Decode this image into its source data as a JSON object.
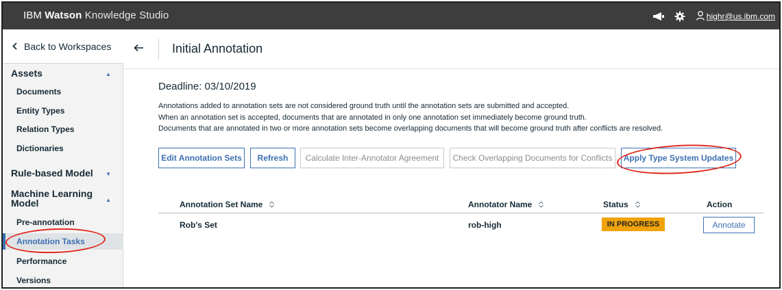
{
  "app": {
    "brand_prefix": "IBM ",
    "brand_bold": "Watson",
    "brand_suffix": " Knowledge Studio",
    "user": "highr@us.ibm.com",
    "icons": [
      "megaphone-icon",
      "gear-icon",
      "user-icon"
    ]
  },
  "sidebar": {
    "back_label": "Back to Workspaces",
    "sections": [
      {
        "label": "Assets",
        "expanded": true,
        "items": [
          "Documents",
          "Entity Types",
          "Relation Types",
          "Dictionaries"
        ]
      },
      {
        "label": "Rule-based Model",
        "expanded": false,
        "items": []
      },
      {
        "label": "Machine Learning Model",
        "label_line1": "Machine Learning",
        "label_line2": "Model",
        "expanded": true,
        "items": [
          "Pre-annotation",
          "Annotation Tasks",
          "Performance",
          "Versions"
        ]
      }
    ],
    "active_item": "Annotation Tasks"
  },
  "main": {
    "title": "Initial Annotation",
    "deadline": "Deadline: 03/10/2019",
    "notes": [
      "Annotations added to annotation sets are not considered ground truth until the annotation sets are submitted and accepted.",
      "When an annotation set is accepted, documents that are annotated in only one annotation set immediately become ground truth.",
      "Documents that are annotated in two or more annotation sets become overlapping documents that will become ground truth after conflicts are resolved."
    ],
    "buttons": [
      {
        "label": "Edit Annotation Sets",
        "enabled": true
      },
      {
        "label": "Refresh",
        "enabled": true
      },
      {
        "label": "Calculate Inter-Annotator Agreement",
        "enabled": false
      },
      {
        "label": "Check Overlapping Documents for Conflicts",
        "enabled": false
      },
      {
        "label": "Apply Type System Updates",
        "enabled": true
      }
    ],
    "table": {
      "columns": [
        "Annotation Set Name",
        "Annotator Name",
        "Status",
        "Action"
      ],
      "rows": [
        {
          "set_name": "Rob's Set",
          "annotator": "rob-high",
          "status": "IN PROGRESS",
          "action": "Annotate"
        }
      ]
    }
  },
  "colors": {
    "topbar": "#3d3d3d",
    "accent": "#3d70b2",
    "status_in_progress": "#f0a30a",
    "highlight_circle": "#e0281b"
  }
}
